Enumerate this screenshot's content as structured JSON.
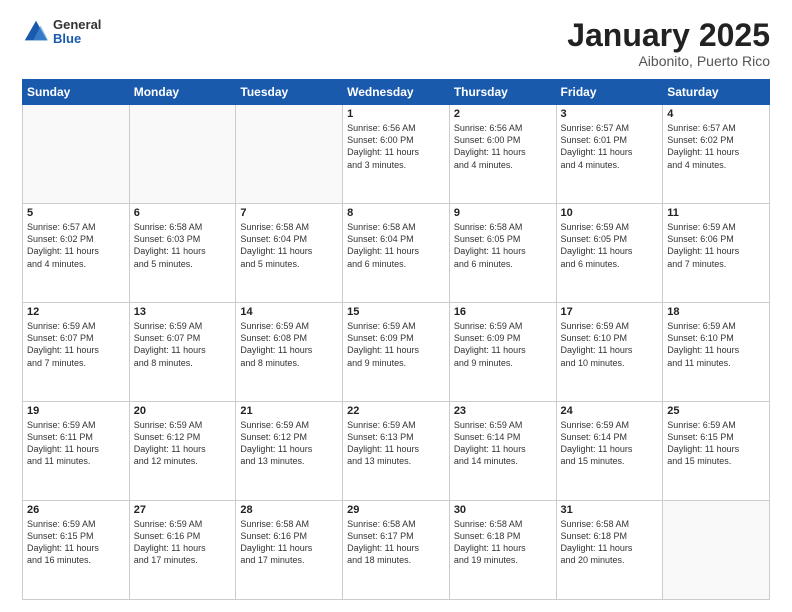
{
  "header": {
    "logo_general": "General",
    "logo_blue": "Blue",
    "title": "January 2025",
    "location": "Aibonito, Puerto Rico"
  },
  "days_of_week": [
    "Sunday",
    "Monday",
    "Tuesday",
    "Wednesday",
    "Thursday",
    "Friday",
    "Saturday"
  ],
  "weeks": [
    [
      {
        "day": "",
        "info": ""
      },
      {
        "day": "",
        "info": ""
      },
      {
        "day": "",
        "info": ""
      },
      {
        "day": "1",
        "info": "Sunrise: 6:56 AM\nSunset: 6:00 PM\nDaylight: 11 hours\nand 3 minutes."
      },
      {
        "day": "2",
        "info": "Sunrise: 6:56 AM\nSunset: 6:00 PM\nDaylight: 11 hours\nand 4 minutes."
      },
      {
        "day": "3",
        "info": "Sunrise: 6:57 AM\nSunset: 6:01 PM\nDaylight: 11 hours\nand 4 minutes."
      },
      {
        "day": "4",
        "info": "Sunrise: 6:57 AM\nSunset: 6:02 PM\nDaylight: 11 hours\nand 4 minutes."
      }
    ],
    [
      {
        "day": "5",
        "info": "Sunrise: 6:57 AM\nSunset: 6:02 PM\nDaylight: 11 hours\nand 4 minutes."
      },
      {
        "day": "6",
        "info": "Sunrise: 6:58 AM\nSunset: 6:03 PM\nDaylight: 11 hours\nand 5 minutes."
      },
      {
        "day": "7",
        "info": "Sunrise: 6:58 AM\nSunset: 6:04 PM\nDaylight: 11 hours\nand 5 minutes."
      },
      {
        "day": "8",
        "info": "Sunrise: 6:58 AM\nSunset: 6:04 PM\nDaylight: 11 hours\nand 6 minutes."
      },
      {
        "day": "9",
        "info": "Sunrise: 6:58 AM\nSunset: 6:05 PM\nDaylight: 11 hours\nand 6 minutes."
      },
      {
        "day": "10",
        "info": "Sunrise: 6:59 AM\nSunset: 6:05 PM\nDaylight: 11 hours\nand 6 minutes."
      },
      {
        "day": "11",
        "info": "Sunrise: 6:59 AM\nSunset: 6:06 PM\nDaylight: 11 hours\nand 7 minutes."
      }
    ],
    [
      {
        "day": "12",
        "info": "Sunrise: 6:59 AM\nSunset: 6:07 PM\nDaylight: 11 hours\nand 7 minutes."
      },
      {
        "day": "13",
        "info": "Sunrise: 6:59 AM\nSunset: 6:07 PM\nDaylight: 11 hours\nand 8 minutes."
      },
      {
        "day": "14",
        "info": "Sunrise: 6:59 AM\nSunset: 6:08 PM\nDaylight: 11 hours\nand 8 minutes."
      },
      {
        "day": "15",
        "info": "Sunrise: 6:59 AM\nSunset: 6:09 PM\nDaylight: 11 hours\nand 9 minutes."
      },
      {
        "day": "16",
        "info": "Sunrise: 6:59 AM\nSunset: 6:09 PM\nDaylight: 11 hours\nand 9 minutes."
      },
      {
        "day": "17",
        "info": "Sunrise: 6:59 AM\nSunset: 6:10 PM\nDaylight: 11 hours\nand 10 minutes."
      },
      {
        "day": "18",
        "info": "Sunrise: 6:59 AM\nSunset: 6:10 PM\nDaylight: 11 hours\nand 11 minutes."
      }
    ],
    [
      {
        "day": "19",
        "info": "Sunrise: 6:59 AM\nSunset: 6:11 PM\nDaylight: 11 hours\nand 11 minutes."
      },
      {
        "day": "20",
        "info": "Sunrise: 6:59 AM\nSunset: 6:12 PM\nDaylight: 11 hours\nand 12 minutes."
      },
      {
        "day": "21",
        "info": "Sunrise: 6:59 AM\nSunset: 6:12 PM\nDaylight: 11 hours\nand 13 minutes."
      },
      {
        "day": "22",
        "info": "Sunrise: 6:59 AM\nSunset: 6:13 PM\nDaylight: 11 hours\nand 13 minutes."
      },
      {
        "day": "23",
        "info": "Sunrise: 6:59 AM\nSunset: 6:14 PM\nDaylight: 11 hours\nand 14 minutes."
      },
      {
        "day": "24",
        "info": "Sunrise: 6:59 AM\nSunset: 6:14 PM\nDaylight: 11 hours\nand 15 minutes."
      },
      {
        "day": "25",
        "info": "Sunrise: 6:59 AM\nSunset: 6:15 PM\nDaylight: 11 hours\nand 15 minutes."
      }
    ],
    [
      {
        "day": "26",
        "info": "Sunrise: 6:59 AM\nSunset: 6:15 PM\nDaylight: 11 hours\nand 16 minutes."
      },
      {
        "day": "27",
        "info": "Sunrise: 6:59 AM\nSunset: 6:16 PM\nDaylight: 11 hours\nand 17 minutes."
      },
      {
        "day": "28",
        "info": "Sunrise: 6:58 AM\nSunset: 6:16 PM\nDaylight: 11 hours\nand 17 minutes."
      },
      {
        "day": "29",
        "info": "Sunrise: 6:58 AM\nSunset: 6:17 PM\nDaylight: 11 hours\nand 18 minutes."
      },
      {
        "day": "30",
        "info": "Sunrise: 6:58 AM\nSunset: 6:18 PM\nDaylight: 11 hours\nand 19 minutes."
      },
      {
        "day": "31",
        "info": "Sunrise: 6:58 AM\nSunset: 6:18 PM\nDaylight: 11 hours\nand 20 minutes."
      },
      {
        "day": "",
        "info": ""
      }
    ]
  ]
}
